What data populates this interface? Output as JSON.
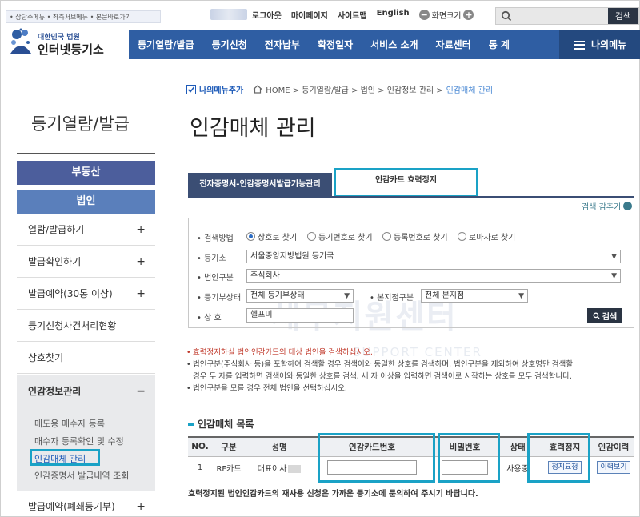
{
  "utility": {
    "skip_links": "• 상단주메뉴 • 좌측서브메뉴 • 본문바로가기",
    "links": [
      "로그아웃",
      "마이페이지",
      "사이트맵",
      "English"
    ],
    "zoom_label": "화면크기",
    "zoom_minus": "−",
    "zoom_plus": "+",
    "search_button": "검색"
  },
  "logo": {
    "line1": "대한민국 법원",
    "line2": "인터넷등기소"
  },
  "gnb": {
    "items": [
      "등기열람/발급",
      "등기신청",
      "전자납부",
      "확정일자",
      "서비스 소개",
      "자료센터",
      "통 계"
    ],
    "my_menu": "나의메뉴"
  },
  "sidebar": {
    "title": "등기열람/발급",
    "cat_realestate": "부동산",
    "cat_corporation": "법인",
    "items": [
      "열람/발급하기",
      "발급확인하기",
      "발급예약(30통 이상)",
      "등기신청사건처리현황",
      "상호찾기",
      "인감정보관리",
      "발급예약(폐쇄등기부)"
    ],
    "sub_items": [
      "매도용 매수자 등록",
      "매수자 등록확인 및 수정",
      "인감매체 관리",
      "인감증명서 발급내역 조회"
    ],
    "plus": "+",
    "minus": "−"
  },
  "breadcrumb": {
    "favorite": "나의메뉴추가",
    "path": "HOME > 등기열람/발급 > 법인 > 인감정보 관리 >",
    "current": "인감매체 관리"
  },
  "page": {
    "title": "인감매체 관리",
    "tab1": "전자증명서-인감증명서발급기능관리",
    "tab2": "인감카드 효력정지",
    "fold_label": "검색 감추기",
    "fold_icon": "−"
  },
  "form": {
    "method_label": "• 검색방법",
    "radios": [
      "상호로 찾기",
      "등기번호로 찾기",
      "등록번호로 찾기",
      "로마자로 찾기"
    ],
    "selected_radio": 0,
    "office_label": "• 등기소",
    "office_value": "서울중앙지방법원 등기국",
    "type_label": "• 법인구분",
    "type_value": "주식회사",
    "status_label": "• 등기부상태",
    "status_value": "전체 등기부상태",
    "branch_label": "• 본지점구분",
    "branch_value": "전체 본지점",
    "name_label": "• 상 호",
    "name_value": "헬프미",
    "search_button": "검색"
  },
  "watermark": {
    "main": "세무지원센터",
    "sub": "SUPPORT CENTER"
  },
  "notes": [
    {
      "text": "효력정지하실 법인인감카드의 대상 법인을 검색하십시오.",
      "red": true
    },
    {
      "text": "법인구분(주식회사 등)을 포함하여 검색할 경우 검색어와 동일한 상호를 검색하며, 법인구분을 제외하여 상호명만 검색할",
      "red": false
    },
    {
      "text": "경우 두 자를 입력하면 검색어와 동일한 상호를 검색, 세 자 이상을 입력하면 검색어로 시작하는 상호를 모두 검색합니다.",
      "red": false,
      "indent": true
    },
    {
      "text": "법인구분을 모를 경우 전체 법인을 선택하십시오.",
      "red": false
    }
  ],
  "table": {
    "section_title": "인감매체 목록",
    "headers": [
      "NO.",
      "구분",
      "성명",
      "인감카드번호",
      "비밀번호",
      "상태",
      "효력정지",
      "인감이력"
    ],
    "row": {
      "no": "1",
      "type": "RF카드",
      "name": "대표이사",
      "status": "사용중",
      "suspend_button": "정지요청",
      "history_button": "이력보기"
    },
    "footnote": "효력정지된 법인인감카드의 재사용 신청은 가까운 등기소에 문의하여 주시기 바랍니다."
  },
  "colors": {
    "navy": "#2f5ea3",
    "highlight": "#1aa2c6",
    "tab_dark": "#3b4e74"
  }
}
